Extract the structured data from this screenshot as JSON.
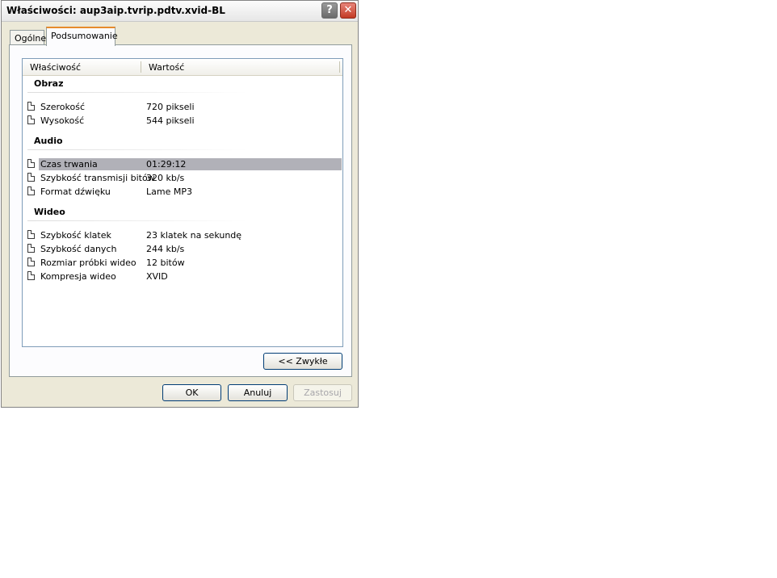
{
  "window": {
    "title": "Właściwości: aup3aip.tvrip.pdtv.xvid-BL",
    "help_glyph": "?",
    "close_glyph": "✕"
  },
  "tabs": [
    {
      "label": "Ogólne"
    },
    {
      "label": "Podsumowanie",
      "selected": true
    }
  ],
  "list": {
    "columns": [
      "Właściwość",
      "Wartość"
    ],
    "groups": [
      {
        "name": "Obraz",
        "rows": [
          {
            "property": "Szerokość",
            "value": "720 pikseli"
          },
          {
            "property": "Wysokość",
            "value": "544 pikseli"
          }
        ]
      },
      {
        "name": "Audio",
        "rows": [
          {
            "property": "Czas trwania",
            "value": "01:29:12",
            "selected": true
          },
          {
            "property": "Szybkość transmisji bitów",
            "value": "320 kb/s"
          },
          {
            "property": "Format dźwięku",
            "value": "Lame MP3"
          }
        ]
      },
      {
        "name": "Wideo",
        "rows": [
          {
            "property": "Szybkość klatek",
            "value": "23 klatek na sekundę"
          },
          {
            "property": "Szybkość danych",
            "value": "244 kb/s"
          },
          {
            "property": "Rozmiar próbki wideo",
            "value": "12 bitów"
          },
          {
            "property": "Kompresja wideo",
            "value": "XVID"
          }
        ]
      }
    ]
  },
  "buttons": {
    "simple": "<< Zwykłe",
    "ok": "OK",
    "cancel": "Anuluj",
    "apply": "Zastosuj"
  },
  "colors": {
    "selection": "#b1b1b8",
    "tab_accent": "#e68b2c",
    "close_button": "#c23a24"
  },
  "icons": {
    "row_icon": "document-icon"
  }
}
